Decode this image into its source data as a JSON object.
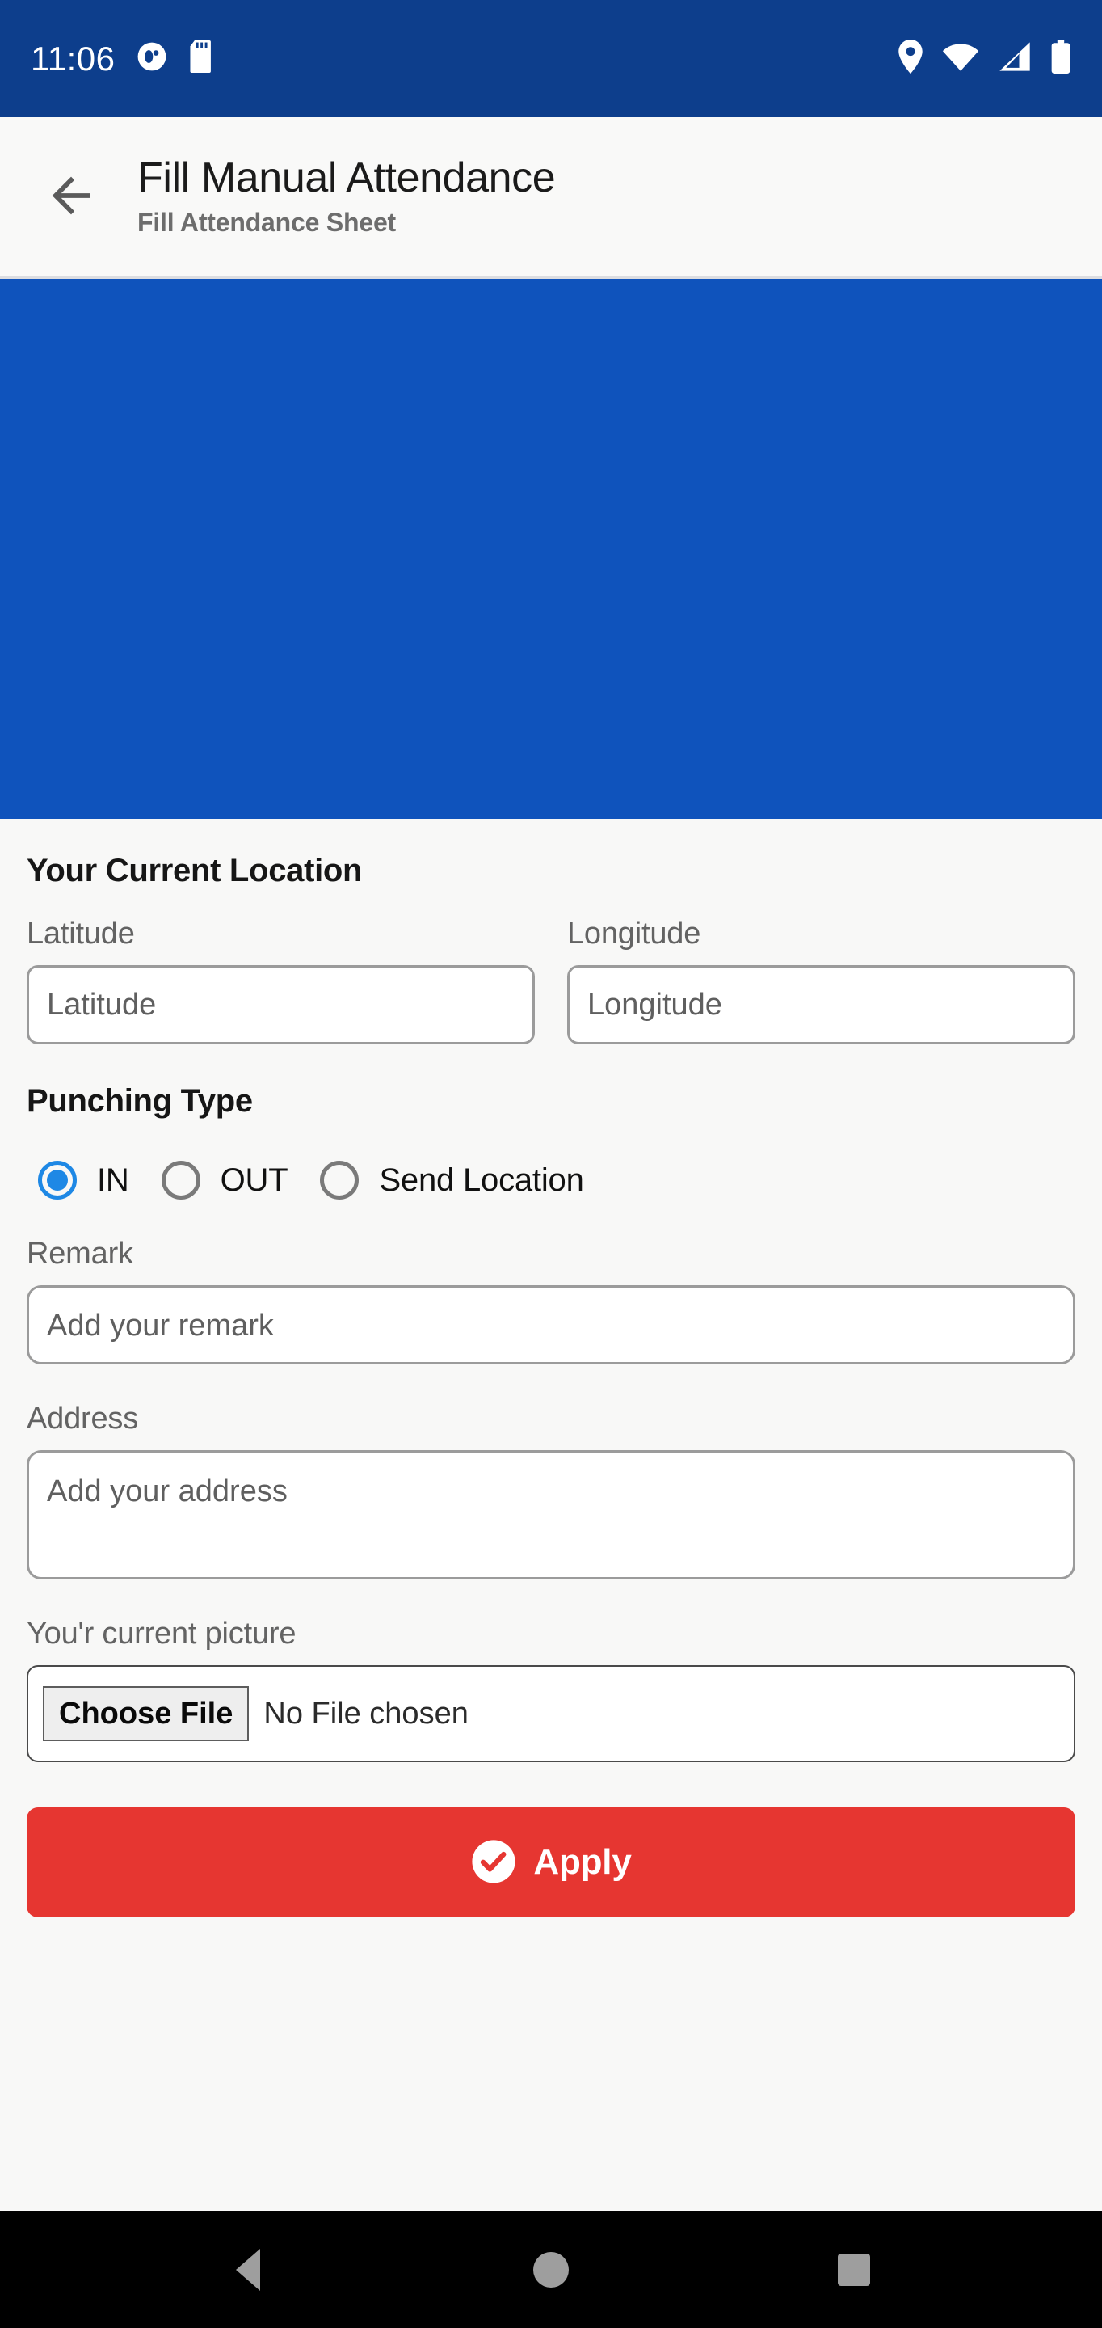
{
  "status_bar": {
    "time": "11:06",
    "left_icons": [
      "app-circle-icon",
      "sd-card-icon"
    ],
    "right_icons": [
      "location-pin-icon",
      "wifi-icon",
      "signal-bars-icon",
      "battery-icon"
    ],
    "background_color": "#0D3E8C"
  },
  "app_bar": {
    "back_icon": "back-arrow-icon",
    "title": "Fill Manual Attendance",
    "subtitle": "Fill Attendance Sheet"
  },
  "map": {
    "label": "map-placeholder",
    "color": "#0F53BC"
  },
  "form": {
    "location_heading": "Your Current Location",
    "latitude": {
      "label": "Latitude",
      "placeholder": "Latitude",
      "value": ""
    },
    "longitude": {
      "label": "Longitude",
      "placeholder": "Longitude",
      "value": ""
    },
    "punching": {
      "heading": "Punching Type",
      "options": [
        {
          "label": "IN",
          "selected": true
        },
        {
          "label": "OUT",
          "selected": false
        },
        {
          "label": "Send Location",
          "selected": false
        }
      ],
      "selected_color": "#1E88E5"
    },
    "remark": {
      "label": "Remark",
      "placeholder": "Add your remark",
      "value": ""
    },
    "address": {
      "label": "Address",
      "placeholder": "Add your address",
      "value": ""
    },
    "picture": {
      "label": "You'r current picture",
      "choose_button": "Choose File",
      "status": "No File chosen"
    },
    "apply": {
      "label": "Apply",
      "icon": "check-circle-icon",
      "color": "#E63631"
    }
  },
  "nav_bar": {
    "back": "nav-back-icon",
    "home": "nav-home-icon",
    "recents": "nav-recents-icon"
  }
}
